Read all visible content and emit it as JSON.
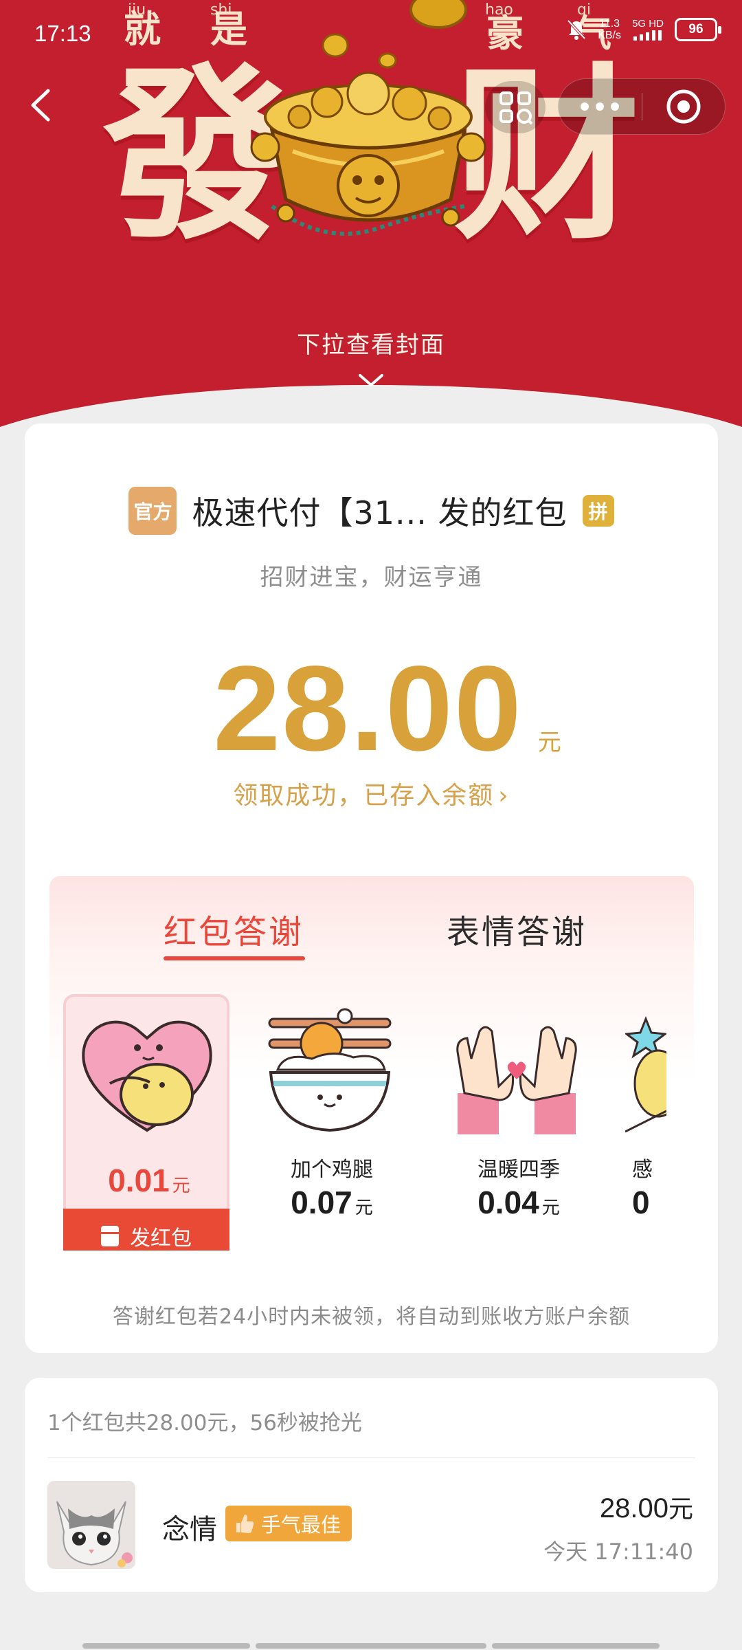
{
  "status_bar": {
    "time": "17:13",
    "speed_value": "11.3",
    "speed_unit": "KB/s",
    "network": "5G HD",
    "battery": "96"
  },
  "cover": {
    "pinyin": [
      "jiu",
      "shi",
      "hao",
      "qi"
    ],
    "small_chars": [
      "就",
      "是",
      "豪",
      "气"
    ],
    "big_chars": [
      "發",
      "财"
    ],
    "pull_tip": "下拉查看封面"
  },
  "envelope": {
    "official_badge": "官方",
    "sender_title": "极速代付【31... 发的红包",
    "pin_badge": "拼",
    "blessing": "招财进宝，财运亨通",
    "amount": "28.00",
    "amount_unit": "元",
    "received_text": "领取成功，已存入余额",
    "received_chevron": "›"
  },
  "thanks": {
    "tabs": [
      {
        "label": "红包答谢",
        "active": true
      },
      {
        "label": "表情答谢",
        "active": false
      }
    ],
    "gifts": [
      {
        "name": "",
        "price": "0.01",
        "unit": "元",
        "icon": "heart-hug-icon",
        "selected": true
      },
      {
        "name": "加个鸡腿",
        "price": "0.07",
        "unit": "元",
        "icon": "chicken-leg-rice-icon",
        "selected": false
      },
      {
        "name": "温暖四季",
        "price": "0.04",
        "unit": "元",
        "icon": "finger-heart-icon",
        "selected": false
      },
      {
        "name": "感",
        "price": "0",
        "unit": "",
        "icon": "star-lantern-icon",
        "selected": false
      }
    ],
    "send_button": "发红包",
    "auto_note": "答谢红包若24小时内未被领，将自动到账收方账户余额"
  },
  "records": {
    "summary": "1个红包共28.00元，56秒被抢光",
    "items": [
      {
        "name": "念情",
        "badge": "手气最佳",
        "amount": "28.00",
        "unit": "元",
        "time": "今天 17:11:40"
      }
    ]
  },
  "colors": {
    "banner_red": "#c41f2e",
    "gold": "#d8a13a",
    "accent_red": "#e8483b",
    "luck_orange": "#f0a63a"
  }
}
